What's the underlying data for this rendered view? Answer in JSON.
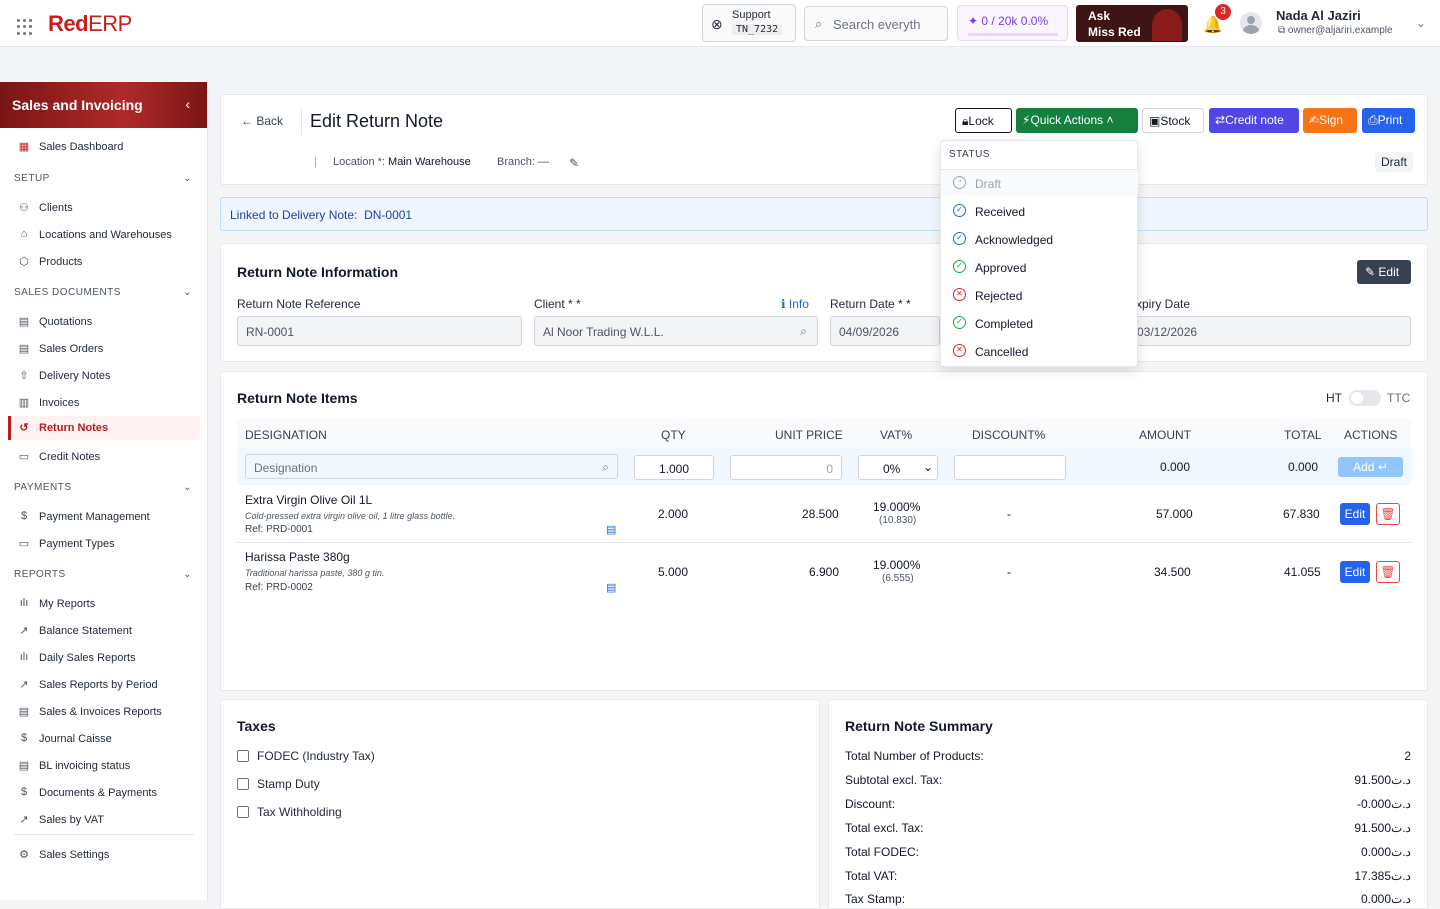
{
  "header": {
    "logo_red": "Red",
    "logo_erp": "ERP",
    "support_label": "Support",
    "support_code": "TN_7232",
    "search_placeholder": "Search everyth",
    "quota": "0 / 20k  0.0%",
    "ask_line1": "Ask",
    "ask_line2": "Miss Red",
    "notif_count": "3",
    "user_name": "Nada Al Jaziri",
    "user_email": "owner@aljariri.example"
  },
  "sidebar": {
    "title": "Sales and Invoicing",
    "dashboard": "Sales Dashboard",
    "sec_setup": "SETUP",
    "clients": "Clients",
    "locations": "Locations and Warehouses",
    "products": "Products",
    "sec_sales": "SALES DOCUMENTS",
    "quotations": "Quotations",
    "sales_orders": "Sales Orders",
    "delivery_notes": "Delivery Notes",
    "invoices": "Invoices",
    "return_notes": "Return Notes",
    "credit_notes": "Credit Notes",
    "sec_payments": "PAYMENTS",
    "payment_mgmt": "Payment Management",
    "payment_types": "Payment Types",
    "sec_reports": "REPORTS",
    "my_reports": "My Reports",
    "balance": "Balance Statement",
    "daily": "Daily Sales Reports",
    "by_period": "Sales Reports by Period",
    "sales_inv": "Sales & Invoices Reports",
    "journal": "Journal Caisse",
    "bl_status": "BL invoicing status",
    "docs_pay": "Documents & Payments",
    "by_vat": "Sales by VAT",
    "settings": "Sales Settings"
  },
  "page": {
    "back": "Back",
    "title": "Edit Return Note",
    "location_label": "Location *:",
    "location_value": "Main Warehouse",
    "branch_label": "Branch:",
    "branch_value": "—",
    "status": "Draft",
    "linked_label": "Linked to Delivery Note:",
    "linked_value": "DN-0001"
  },
  "toolbar": {
    "lock": "Lock",
    "quick": "Quick Actions",
    "stock": "Stock",
    "credit": "Credit note",
    "sign": "Sign",
    "print": "Print"
  },
  "status_menu": {
    "heading": "STATUS",
    "options": [
      "Draft",
      "Received",
      "Acknowledged",
      "Approved",
      "Rejected",
      "Completed",
      "Cancelled"
    ],
    "colors": {
      "ok": "#16a34a",
      "blue": "#2563eb",
      "bad": "#dc2626",
      "muted": "#9ca3af"
    }
  },
  "info": {
    "heading": "Return Note Information",
    "edit": "Edit",
    "ref_label": "Return Note Reference",
    "ref_value": "RN-0001",
    "client_label": "Client * *",
    "client_info": "Info",
    "client_value": "Al Noor Trading W.L.L.",
    "date_label": "Return Date * *",
    "date_value": "04/09/2026",
    "expiry_label": "xpiry Date",
    "expiry_value": "03/12/2026"
  },
  "items": {
    "heading": "Return Note Items",
    "ht": "HT",
    "ttc": "TTC",
    "cols": [
      "DESIGNATION",
      "QTY",
      "UNIT PRICE",
      "VAT%",
      "DISCOUNT%",
      "AMOUNT",
      "TOTAL",
      "ACTIONS"
    ],
    "new_row": {
      "designation_placeholder": "Designation",
      "qty": "1.000",
      "unit_price": "0",
      "vat": "0%",
      "amount": "0.000",
      "total": "0.000",
      "add": "Add"
    },
    "rows": [
      {
        "name": "Extra Virgin Olive Oil 1L",
        "desc": "Cold-pressed extra virgin olive oil, 1 litre glass bottle.",
        "ref": "Ref: PRD-0001",
        "qty": "2.000",
        "price": "28.500",
        "vat": "19.000%",
        "vat_amt": "(10.830)",
        "disc": "-",
        "amount": "57.000",
        "total": "67.830",
        "edit": "Edit"
      },
      {
        "name": "Harissa Paste 380g",
        "desc": "Traditional harissa paste, 380 g tin.",
        "ref": "Ref: PRD-0002",
        "qty": "5.000",
        "price": "6.900",
        "vat": "19.000%",
        "vat_amt": "(6.555)",
        "disc": "-",
        "amount": "34.500",
        "total": "41.055",
        "edit": "Edit"
      }
    ]
  },
  "taxes": {
    "heading": "Taxes",
    "fodec": "FODEC (Industry Tax)",
    "stamp": "Stamp Duty",
    "withholding": "Tax Withholding"
  },
  "summary": {
    "heading": "Return Note Summary",
    "rows": [
      {
        "label": "Total Number of Products:",
        "value": "2"
      },
      {
        "label": "Subtotal excl. Tax:",
        "value": "91.500د.ت"
      },
      {
        "label": "Discount:",
        "value": "-0.000د.ت"
      },
      {
        "label": "Total excl. Tax:",
        "value": "91.500د.ت"
      },
      {
        "label": "Total FODEC:",
        "value": "0.000د.ت"
      },
      {
        "label": "Total VAT:",
        "value": "17.385د.ت"
      },
      {
        "label": "Tax Stamp:",
        "value": "0.000د.ت"
      }
    ]
  }
}
